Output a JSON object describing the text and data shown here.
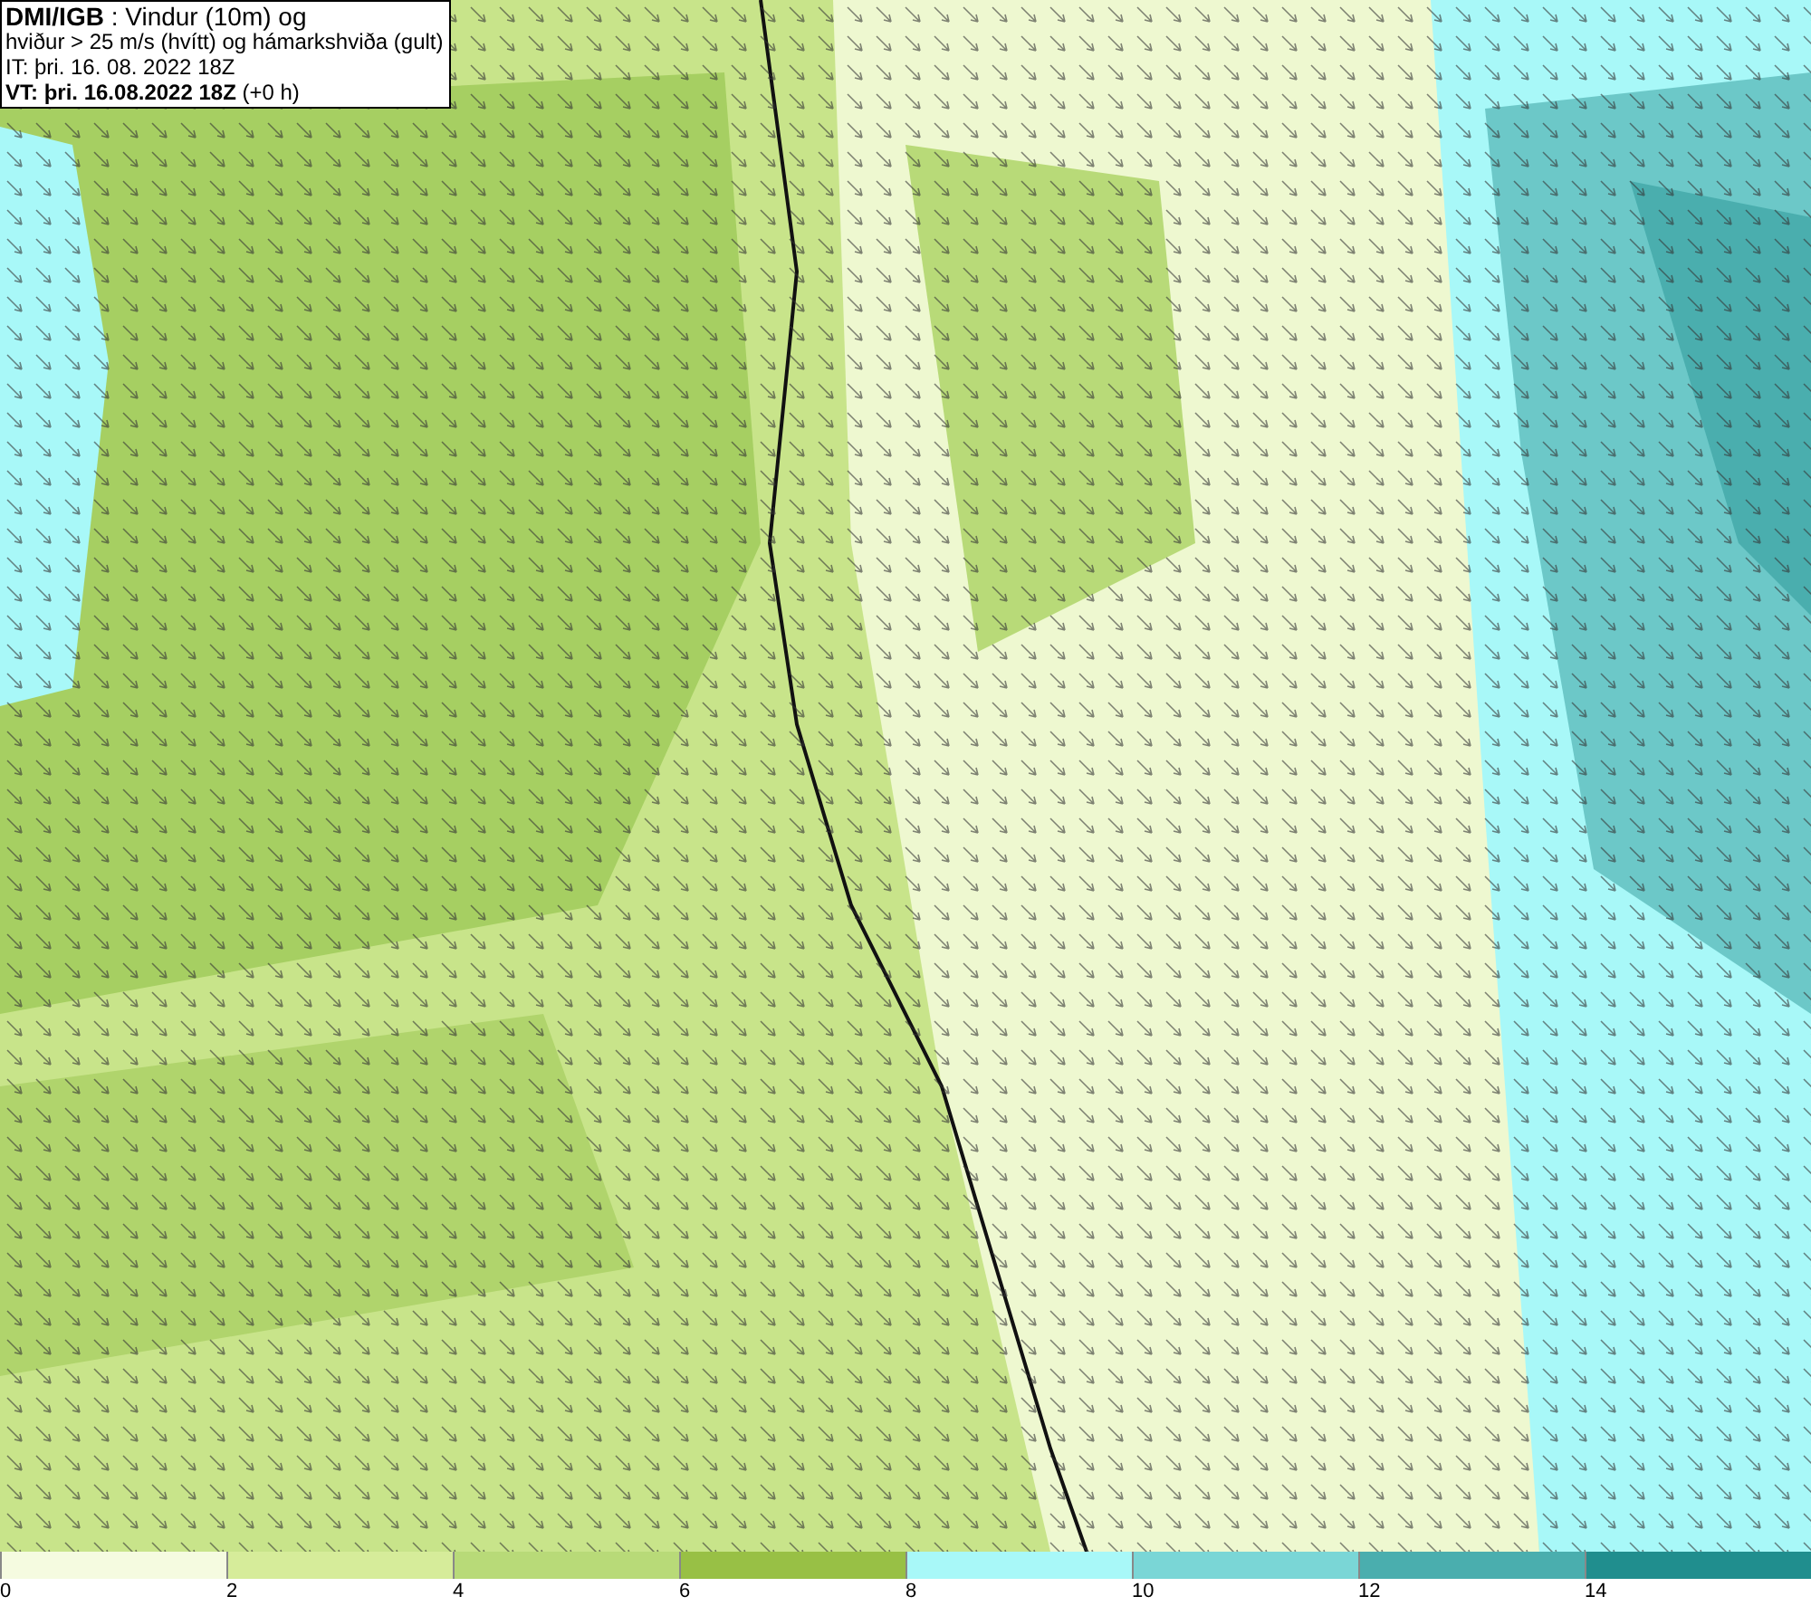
{
  "header": {
    "lines": [
      "**DMI/IGB** : Vindur (10m) og",
      "hviður > 25 m/s (hvítt) og hámarkshviða (gult)",
      "IT: þri. 16. 08. 2022 18Z",
      "**VT: þri. 16.08.2022 18Z** (+0 h)"
    ]
  },
  "legend": {
    "bins": [
      {
        "label": "0",
        "color": "#f5fbe0"
      },
      {
        "label": "2",
        "color": "#d6ec9a"
      },
      {
        "label": "4",
        "color": "#b8da78"
      },
      {
        "label": "6",
        "color": "#98c045"
      },
      {
        "label": "8",
        "color": "#a8f8f8"
      },
      {
        "label": "10",
        "color": "#7ad6d6"
      },
      {
        "label": "12",
        "color": "#4aaeae"
      },
      {
        "label": "14",
        "color": "#208e8e"
      }
    ]
  }
}
